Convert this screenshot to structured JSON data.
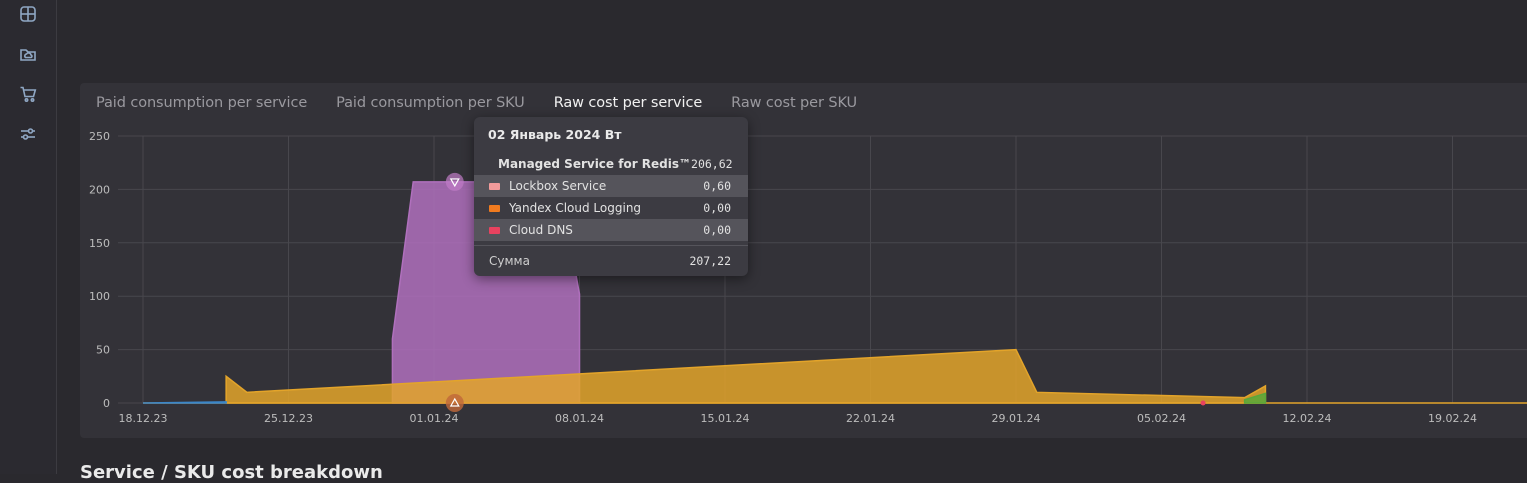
{
  "sidebar": {
    "icons": [
      "grid-icon",
      "cloud-folder-icon",
      "cart-icon",
      "sliders-icon"
    ]
  },
  "tabs": [
    {
      "label": "Paid consumption per service",
      "active": false
    },
    {
      "label": "Paid consumption per SKU",
      "active": false
    },
    {
      "label": "Raw cost per service",
      "active": true
    },
    {
      "label": "Raw cost per SKU",
      "active": false
    }
  ],
  "tooltip": {
    "title": "02 Январь 2024 Вт",
    "rows": [
      {
        "name": "Managed Service for Redis™",
        "value": "206,62",
        "color": "#b070bd",
        "bold": true,
        "highlight": false
      },
      {
        "name": "Lockbox Service",
        "value": "0,60",
        "color": "#f29b9b",
        "bold": false,
        "highlight": true
      },
      {
        "name": "Yandex Cloud Logging",
        "value": "0,00",
        "color": "#f07b1f",
        "bold": false,
        "highlight": false
      },
      {
        "name": "Cloud DNS",
        "value": "0,00",
        "color": "#e8425f",
        "bold": false,
        "highlight": true
      }
    ],
    "sum_label": "Сумма",
    "sum_value": "207,22"
  },
  "chart_data": {
    "type": "area",
    "x": [
      "18.12.23",
      "25.12.23",
      "01.01.24",
      "08.01.24",
      "15.01.24",
      "22.01.24",
      "29.01.24",
      "05.02.24",
      "12.02.24",
      "19.02.24"
    ],
    "x_tick_labels": [
      "18.12.23",
      "25.12.23",
      "01.01.24",
      "08.01.24",
      "15.01.24",
      "22.01.24",
      "29.01.24",
      "05.02.24",
      "12.02.24",
      "19.02.24"
    ],
    "y_ticks": [
      0,
      50,
      100,
      150,
      200,
      250
    ],
    "ylim": [
      0,
      250
    ],
    "grid": true,
    "series": [
      {
        "name": "Managed Service for Redis™",
        "color": "#b070bd",
        "points": [
          [
            "30.12.23",
            60
          ],
          [
            "31.12.23",
            207
          ],
          [
            "02.01.24",
            207
          ],
          [
            "07.01.24",
            207
          ],
          [
            "08.01.24",
            102
          ],
          [
            "08.01.24",
            0
          ]
        ]
      },
      {
        "name": "Yandex Cloud Logging",
        "color": "#e3a42a",
        "points": [
          [
            "22.12.23",
            25
          ],
          [
            "23.12.23",
            10
          ],
          [
            "29.01.24",
            50
          ],
          [
            "30.01.24",
            10
          ],
          [
            "09.02.24",
            5
          ],
          [
            "10.02.24",
            16
          ]
        ]
      },
      {
        "name": "green-series",
        "color": "#59a83a",
        "points": [
          [
            "09.02.24",
            3
          ],
          [
            "10.02.24",
            9
          ]
        ]
      },
      {
        "name": "blue-series",
        "color": "#3b86c9",
        "points": [
          [
            "18.12.23",
            0
          ],
          [
            "22.12.23",
            1
          ]
        ]
      }
    ],
    "hover_date": "02.01.24"
  },
  "bottom": {
    "heading": "Service / SKU cost breakdown"
  }
}
